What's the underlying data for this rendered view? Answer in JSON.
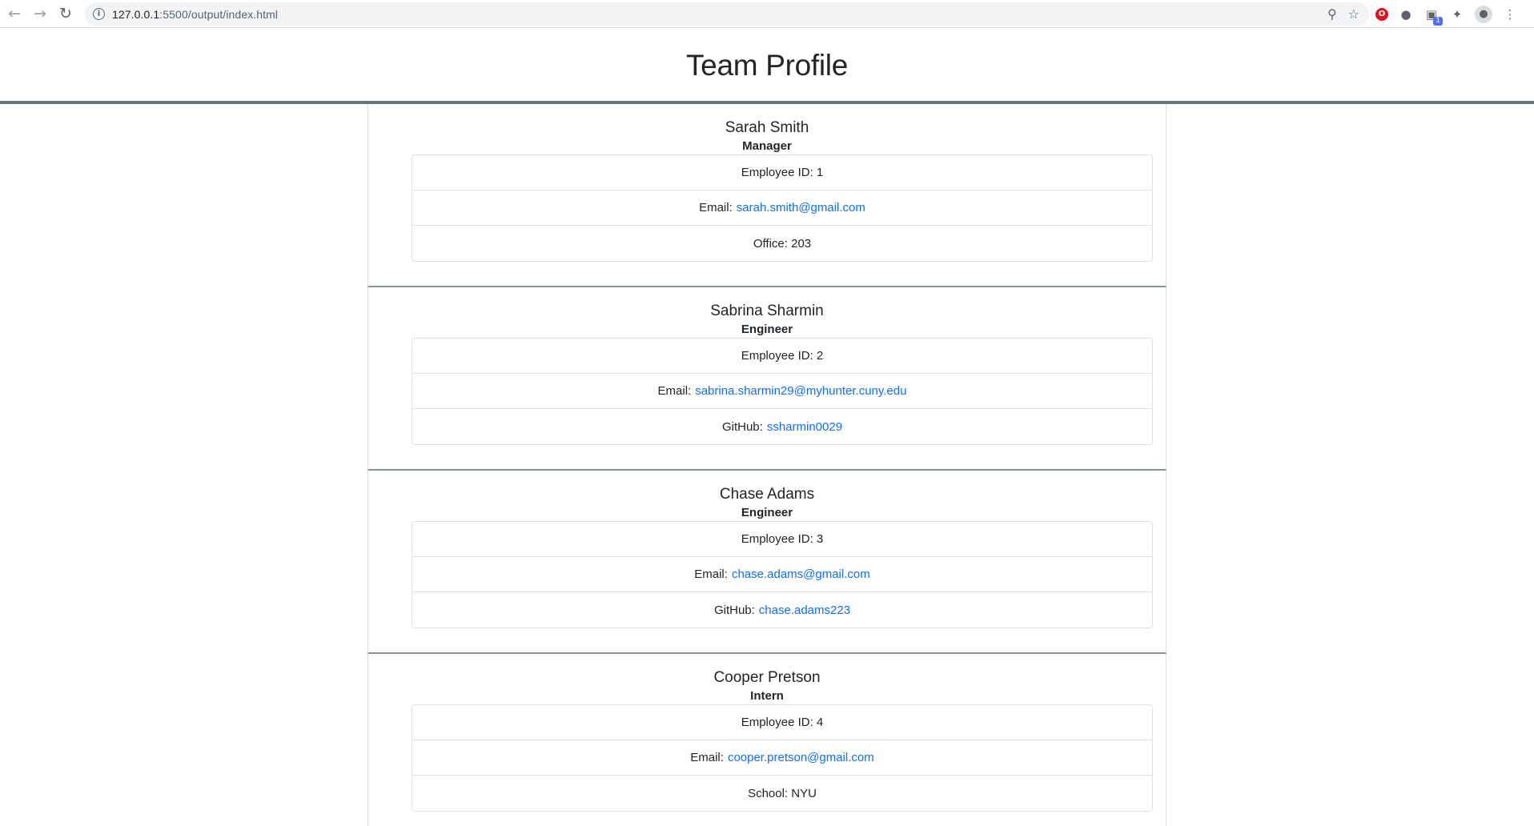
{
  "browser": {
    "url_host": "127.0.0.1",
    "url_rest": ":5500/output/index.html",
    "extension_badge": "1"
  },
  "page": {
    "title": "Team Profile"
  },
  "employees": [
    {
      "name": "Sarah Smith",
      "role": "Manager",
      "id_label": "Employee ID: 1",
      "email_label": "Email:",
      "email": "sarah.smith@gmail.com",
      "extra_label": "Office: 203",
      "extra_link": ""
    },
    {
      "name": "Sabrina Sharmin",
      "role": "Engineer",
      "id_label": "Employee ID: 2",
      "email_label": "Email:",
      "email": "sabrina.sharmin29@myhunter.cuny.edu",
      "extra_label": "GitHub:",
      "extra_link": "ssharmin0029"
    },
    {
      "name": "Chase Adams",
      "role": "Engineer",
      "id_label": "Employee ID: 3",
      "email_label": "Email:",
      "email": "chase.adams@gmail.com",
      "extra_label": "GitHub:",
      "extra_link": "chase.adams223"
    },
    {
      "name": "Cooper Pretson",
      "role": "Intern",
      "id_label": "Employee ID: 4",
      "email_label": "Email:",
      "email": "cooper.pretson@gmail.com",
      "extra_label": "School: NYU",
      "extra_link": ""
    }
  ]
}
